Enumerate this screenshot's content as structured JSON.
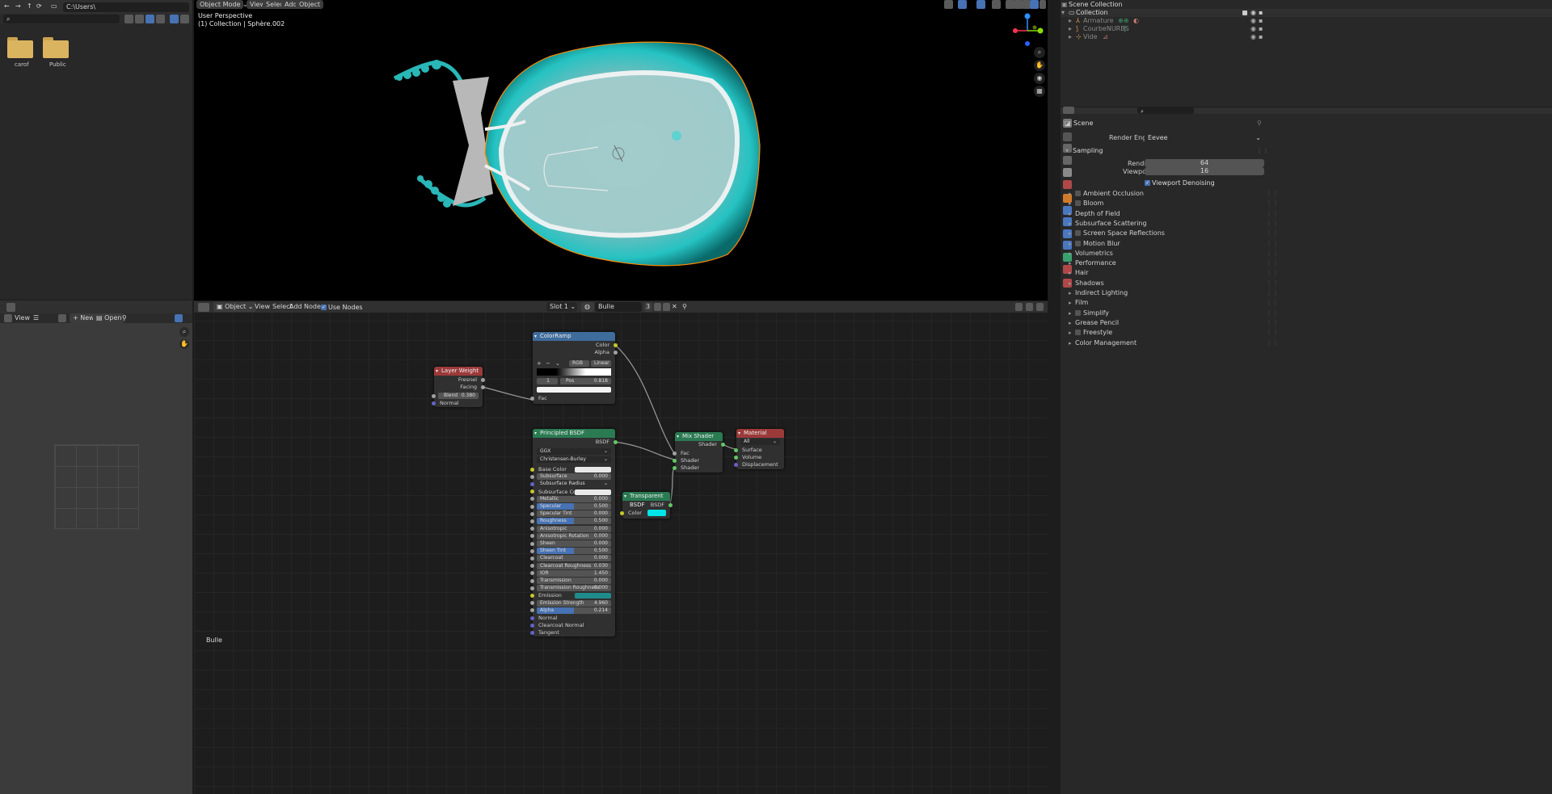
{
  "file_browser": {
    "path": "C:\\Users\\",
    "search_placeholder": "",
    "folders": [
      {
        "name": "carof"
      },
      {
        "name": "Public"
      }
    ]
  },
  "image_editor": {
    "view_menu": "View",
    "new_button": "New",
    "open_button": "Open"
  },
  "viewport": {
    "mode": "Object Mode",
    "menus": [
      "View",
      "Select",
      "Add",
      "Object"
    ],
    "overlay_title": "User Perspective",
    "overlay_subtitle": "(1) Collection | Sphère.002",
    "colors": {
      "object": "#25c2c2",
      "outline": "#ff8c00"
    }
  },
  "node_editor": {
    "object_dropdown": "Object",
    "menus": [
      "View",
      "Select",
      "Add",
      "Node"
    ],
    "use_nodes_label": "Use Nodes",
    "use_nodes_checked": true,
    "slot": "Slot 1",
    "material_name": "Bulle",
    "material_users": "3",
    "footer_label": "Bulle",
    "nodes": {
      "color_ramp": {
        "title": "ColorRamp",
        "out_color": "Color",
        "out_alpha": "Alpha",
        "color_mode": "RGB",
        "interpolation": "Linear",
        "index": "1",
        "pos_label": "Pos",
        "pos_value": "0.818",
        "in_fac": "Fac"
      },
      "layer_weight": {
        "title": "Layer Weight",
        "out_fresnel": "Fresnel",
        "out_facing": "Facing",
        "blend_label": "Blend",
        "blend_value": "0.380",
        "in_normal": "Normal"
      },
      "principled": {
        "title": "Principled BSDF",
        "out_bsdf": "BSDF",
        "distribution": "GGX",
        "subsurface_method": "Christensen-Burley",
        "inputs": [
          {
            "label": "Base Color",
            "value": "",
            "kind": "color",
            "color": "#e8e8e8",
            "socket": "y"
          },
          {
            "label": "Subsurface",
            "value": "0.000",
            "kind": "field",
            "socket": "gr"
          },
          {
            "label": "Subsurface Radius",
            "value": "",
            "kind": "drop",
            "socket": "b"
          },
          {
            "label": "Subsurface Color",
            "value": "",
            "kind": "color",
            "color": "#e8e8e8",
            "socket": "y"
          },
          {
            "label": "Metallic",
            "value": "0.000",
            "kind": "field",
            "socket": "gr"
          },
          {
            "label": "Specular",
            "value": "0.500",
            "kind": "hi",
            "socket": "gr"
          },
          {
            "label": "Specular Tint",
            "value": "0.000",
            "kind": "field",
            "socket": "gr"
          },
          {
            "label": "Roughness",
            "value": "0.500",
            "kind": "hi",
            "socket": "gr"
          },
          {
            "label": "Anisotropic",
            "value": "0.000",
            "kind": "field",
            "socket": "gr"
          },
          {
            "label": "Anisotropic Rotation",
            "value": "0.000",
            "kind": "field",
            "socket": "gr"
          },
          {
            "label": "Sheen",
            "value": "0.000",
            "kind": "field",
            "socket": "gr"
          },
          {
            "label": "Sheen Tint",
            "value": "0.500",
            "kind": "hi",
            "socket": "gr"
          },
          {
            "label": "Clearcoat",
            "value": "0.000",
            "kind": "field",
            "socket": "gr"
          },
          {
            "label": "Clearcoat Roughness",
            "value": "0.030",
            "kind": "field",
            "socket": "gr"
          },
          {
            "label": "IOR",
            "value": "1.450",
            "kind": "field",
            "socket": "gr"
          },
          {
            "label": "Transmission",
            "value": "0.000",
            "kind": "field",
            "socket": "gr"
          },
          {
            "label": "Transmission Roughness",
            "value": "0.000",
            "kind": "field",
            "socket": "gr"
          },
          {
            "label": "Emission",
            "value": "",
            "kind": "color",
            "color": "#1f8b8b",
            "socket": "y"
          },
          {
            "label": "Emission Strength",
            "value": "4.960",
            "kind": "field",
            "socket": "gr"
          },
          {
            "label": "Alpha",
            "value": "0.214",
            "kind": "hi",
            "socket": "gr"
          },
          {
            "label": "Normal",
            "value": "",
            "kind": "plain",
            "socket": "b"
          },
          {
            "label": "Clearcoat Normal",
            "value": "",
            "kind": "plain",
            "socket": "b"
          },
          {
            "label": "Tangent",
            "value": "",
            "kind": "plain",
            "socket": "b"
          }
        ]
      },
      "mix_shader": {
        "title": "Mix Shader",
        "out_shader": "Shader",
        "in_fac": "Fac",
        "in_shader1": "Shader",
        "in_shader2": "Shader"
      },
      "material_output": {
        "title": "Material Output",
        "target": "All",
        "in_surface": "Surface",
        "in_volume": "Volume",
        "in_displacement": "Displacement"
      },
      "transparent": {
        "title": "Transparent BSDF",
        "out_bsdf": "BSDF",
        "in_color": "Color",
        "color": "#00e5e5"
      }
    }
  },
  "outliner": {
    "root": "Scene Collection",
    "collection": "Collection",
    "items": [
      "Armature",
      "CourbeNURBS",
      "Vide"
    ]
  },
  "properties": {
    "search_placeholder": "",
    "context": "Scene",
    "render_engine_label": "Render Engine",
    "render_engine": "Eevee",
    "sampling": {
      "title": "Sampling",
      "render_label": "Render",
      "render_value": "64",
      "viewport_label": "Viewport",
      "viewport_value": "16",
      "denoise_label": "Viewport Denoising",
      "denoise_checked": true
    },
    "sections": [
      {
        "label": "Ambient Occlusion",
        "checkbox": true
      },
      {
        "label": "Bloom",
        "checkbox": true
      },
      {
        "label": "Depth of Field",
        "checkbox": false
      },
      {
        "label": "Subsurface Scattering",
        "checkbox": false
      },
      {
        "label": "Screen Space Reflections",
        "checkbox": true
      },
      {
        "label": "Motion Blur",
        "checkbox": true
      },
      {
        "label": "Volumetrics",
        "checkbox": false
      },
      {
        "label": "Performance",
        "checkbox": false
      },
      {
        "label": "Hair",
        "checkbox": false
      },
      {
        "label": "Shadows",
        "checkbox": false
      },
      {
        "label": "Indirect Lighting",
        "checkbox": false
      },
      {
        "label": "Film",
        "checkbox": false
      },
      {
        "label": "Simplify",
        "checkbox": true
      },
      {
        "label": "Grease Pencil",
        "checkbox": false
      },
      {
        "label": "Freestyle",
        "checkbox": true
      },
      {
        "label": "Color Management",
        "checkbox": false
      }
    ]
  }
}
